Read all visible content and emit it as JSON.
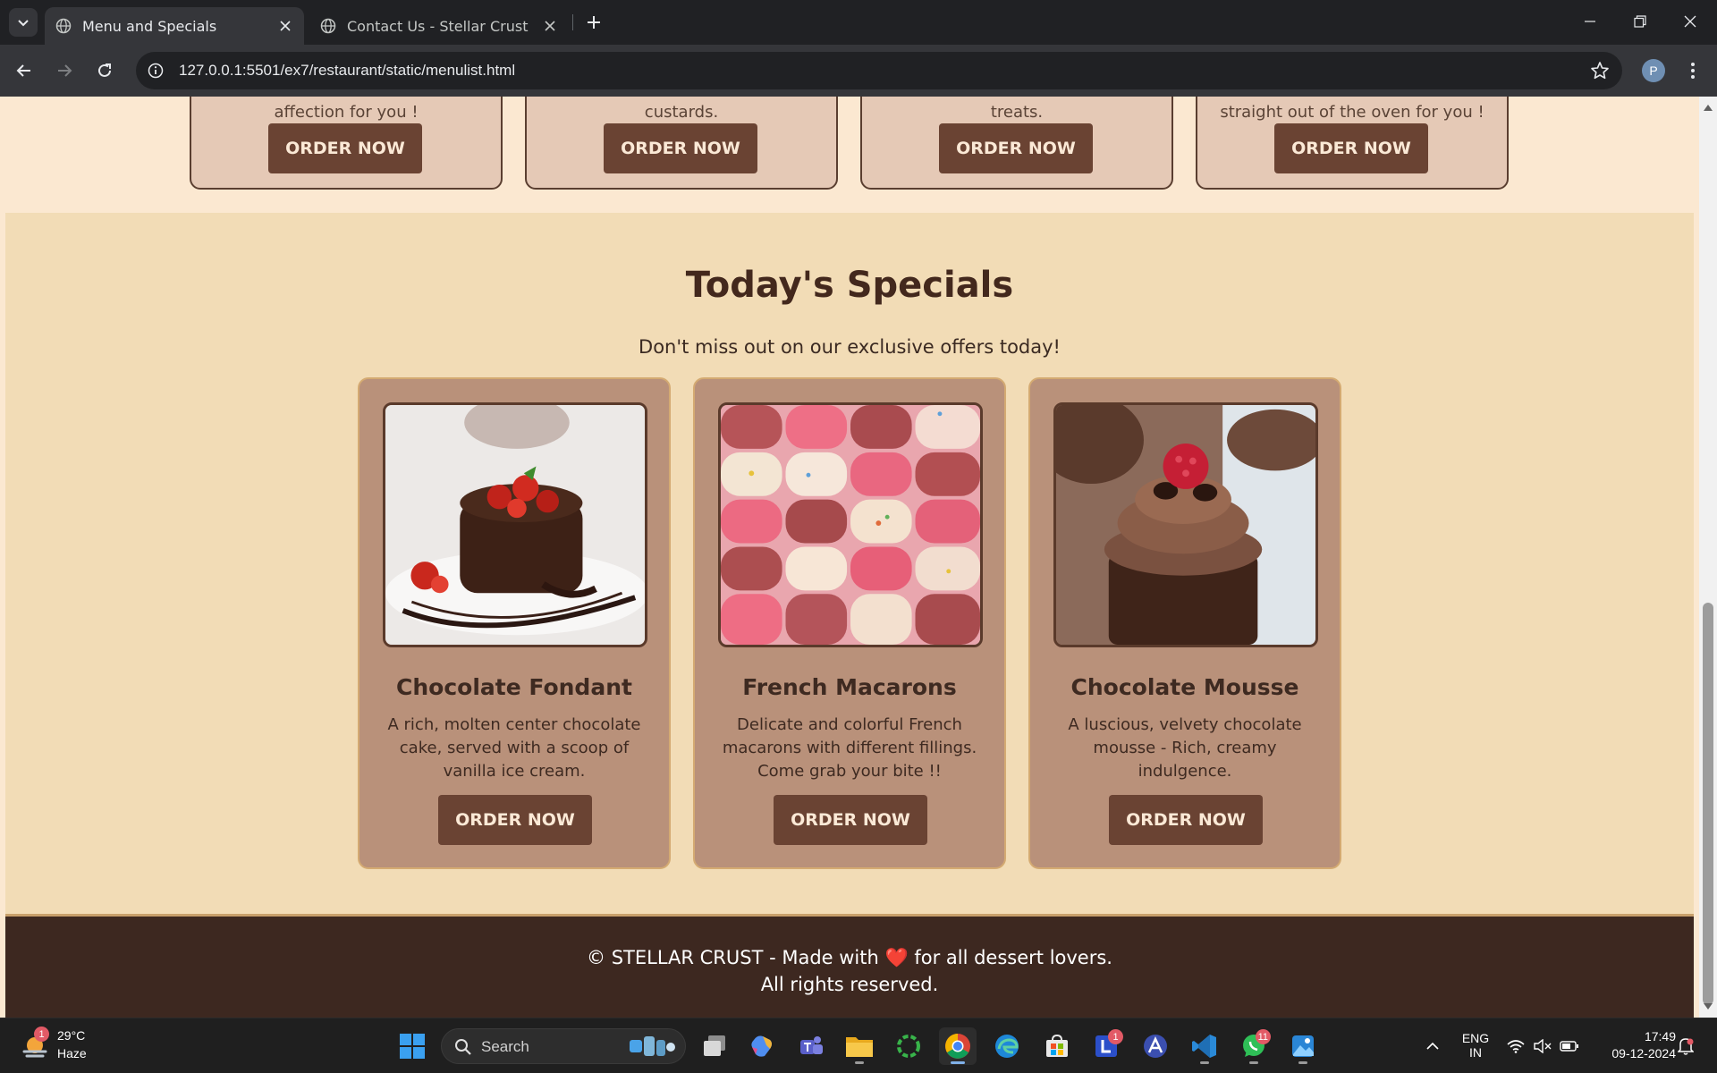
{
  "browser": {
    "tabs": [
      {
        "title": "Menu and Specials",
        "active": true
      },
      {
        "title": "Contact Us - Stellar Crust",
        "active": false
      }
    ],
    "url": "127.0.0.1:5501/ex7/restaurant/static/menulist.html",
    "profile_initial": "P"
  },
  "menu_row": {
    "cards": [
      {
        "partial_text": "affection for you !",
        "button": "ORDER NOW"
      },
      {
        "partial_text": "custards.",
        "button": "ORDER NOW"
      },
      {
        "partial_text": "treats.",
        "button": "ORDER NOW"
      },
      {
        "partial_text": "straight out of the oven for you !",
        "button": "ORDER NOW"
      }
    ]
  },
  "specials": {
    "title": "Today's Specials",
    "subtitle": "Don't miss out on our exclusive offers today!",
    "items": [
      {
        "name": "Chocolate Fondant",
        "description": "A rich, molten center chocolate cake, served with a scoop of vanilla ice cream.",
        "button": "ORDER NOW",
        "image": "chocolate-fondant-image"
      },
      {
        "name": "French Macarons",
        "description": "Delicate and colorful French macarons with different fillings. Come grab your bite !!",
        "button": "ORDER NOW",
        "image": "french-macarons-image"
      },
      {
        "name": "Chocolate Mousse",
        "description": "A luscious, velvety chocolate mousse - Rich, creamy indulgence.",
        "button": "ORDER NOW",
        "image": "chocolate-mousse-image"
      }
    ]
  },
  "footer": {
    "line1_prefix": "© STELLAR CRUST - Made with",
    "heart": "❤️",
    "line1_suffix": "for all dessert lovers.",
    "line2": "All rights reserved."
  },
  "taskbar": {
    "weather_temp": "29°C",
    "weather_cond": "Haze",
    "weather_badge": "1",
    "search_label": "Search",
    "lens_badge": "1",
    "whatsapp_badge": "11",
    "lang_top": "ENG",
    "lang_bottom": "IN",
    "time": "17:49",
    "date": "09-12-2024"
  },
  "colors": {
    "page_bg": "#fbe8d1",
    "specials_bg": "#f2dcb6",
    "card_bg": "#b9917a",
    "button_bg": "#6a4333",
    "footer_bg": "#3d2820"
  }
}
